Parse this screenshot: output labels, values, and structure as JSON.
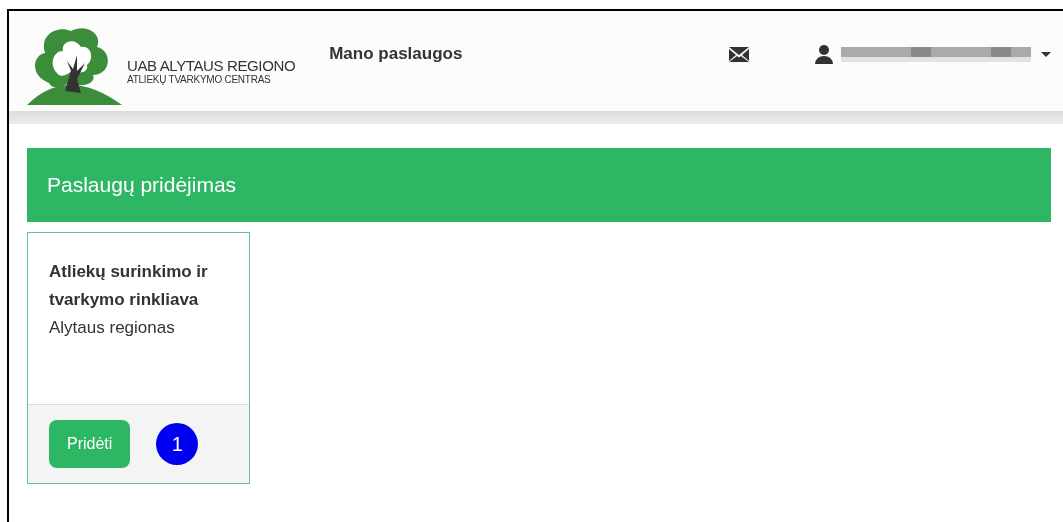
{
  "header": {
    "logo_line_1": "UAB ALYTAUS REGIONO",
    "logo_line_2": "ATLIEKŲ TVARKYMO CENTRAS",
    "nav": [
      {
        "label": "Mano paslaugos"
      }
    ]
  },
  "banner": {
    "title": "Paslaugų pridėjimas"
  },
  "cards": [
    {
      "title": "Atliekų surinkimo ir tvarkymo rinkliava",
      "subtitle": "Alytaus regionas",
      "button": "Pridėti",
      "marker": "1"
    }
  ]
}
